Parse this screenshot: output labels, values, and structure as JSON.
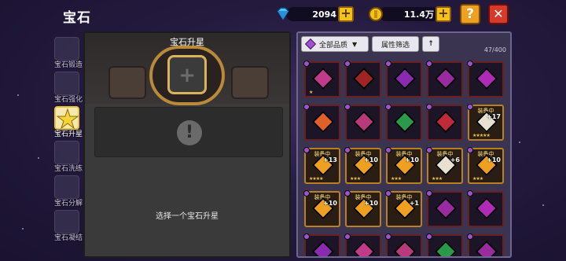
{
  "header": {
    "title": "宝石",
    "diamonds": "2094",
    "gold": "11.4万",
    "help_label": "?",
    "close_label": "✕",
    "diamond_color": "#4fc3f7",
    "gold_color": "#f5c21b"
  },
  "sidebar": {
    "items": [
      {
        "label": "宝石锻造",
        "icon": "gem-forge-icon",
        "active": false
      },
      {
        "label": "宝石强化",
        "icon": "gem-enhance-icon",
        "active": false
      },
      {
        "label": "宝石升星",
        "icon": "star-icon",
        "active": true
      },
      {
        "label": "宝石洗练",
        "icon": "gem-reroll-icon",
        "active": false
      },
      {
        "label": "宝石分解",
        "icon": "gem-dismantle-icon",
        "active": false
      },
      {
        "label": "宝石凝结",
        "icon": "gem-condense-icon",
        "active": false
      }
    ]
  },
  "center": {
    "title": "宝石升星",
    "slot_symbol": "+",
    "info_symbol": "!",
    "hint": "选择一个宝石升星"
  },
  "inventory": {
    "quality_filter": "全部品质",
    "attribute_filter": "属性筛选",
    "sort_symbol": "↑",
    "count": "47/400",
    "equipped_label": "装备中",
    "cells": [
      {
        "gem": "#c23a8a",
        "border": "red",
        "level": "",
        "equipped": false,
        "stars": "★"
      },
      {
        "gem": "#a02424",
        "border": "red",
        "level": "",
        "equipped": false,
        "stars": ""
      },
      {
        "gem": "#8a2ab0",
        "border": "red",
        "level": "",
        "equipped": false,
        "stars": ""
      },
      {
        "gem": "#9a2aa0",
        "border": "red",
        "level": "",
        "equipped": false,
        "stars": ""
      },
      {
        "gem": "#b02ab8",
        "border": "red",
        "level": "",
        "equipped": false,
        "stars": ""
      },
      {
        "gem": "#e0602a",
        "border": "red",
        "level": "",
        "equipped": false,
        "stars": ""
      },
      {
        "gem": "#b83a7a",
        "border": "red",
        "level": "",
        "equipped": false,
        "stars": ""
      },
      {
        "gem": "#2a9a4a",
        "border": "red",
        "level": "",
        "equipped": false,
        "stars": ""
      },
      {
        "gem": "#c02a3a",
        "border": "red",
        "level": "",
        "equipped": false,
        "stars": ""
      },
      {
        "gem": "#e8e0d0",
        "border": "gold",
        "level": "+17",
        "equipped": true,
        "stars": "★★★★★"
      },
      {
        "gem": "#f0a020",
        "border": "gold",
        "level": "+13",
        "equipped": true,
        "stars": "★★★★"
      },
      {
        "gem": "#f0a020",
        "border": "gold",
        "level": "+10",
        "equipped": true,
        "stars": "★★★"
      },
      {
        "gem": "#f0a020",
        "border": "gold",
        "level": "+10",
        "equipped": true,
        "stars": "★★★"
      },
      {
        "gem": "#e8e0d0",
        "border": "gold",
        "level": "+6",
        "equipped": true,
        "stars": "★★★"
      },
      {
        "gem": "#f0a020",
        "border": "gold",
        "level": "+10",
        "equipped": true,
        "stars": "★★★"
      },
      {
        "gem": "#f0a020",
        "border": "gold",
        "level": "+10",
        "equipped": true,
        "stars": ""
      },
      {
        "gem": "#f0a020",
        "border": "gold",
        "level": "+10",
        "equipped": true,
        "stars": ""
      },
      {
        "gem": "#f0a020",
        "border": "gold",
        "level": "+1",
        "equipped": true,
        "stars": ""
      },
      {
        "gem": "#9a2aa0",
        "border": "red",
        "level": "",
        "equipped": false,
        "stars": ""
      },
      {
        "gem": "#b02ab8",
        "border": "red",
        "level": "",
        "equipped": false,
        "stars": ""
      },
      {
        "gem": "#8a2ab0",
        "border": "red",
        "level": "",
        "equipped": false,
        "stars": ""
      },
      {
        "gem": "#c23a8a",
        "border": "red",
        "level": "",
        "equipped": false,
        "stars": ""
      },
      {
        "gem": "#b83a7a",
        "border": "red",
        "level": "",
        "equipped": false,
        "stars": ""
      },
      {
        "gem": "#2a9a4a",
        "border": "red",
        "level": "",
        "equipped": false,
        "stars": ""
      },
      {
        "gem": "#9a2aa0",
        "border": "red",
        "level": "",
        "equipped": false,
        "stars": ""
      }
    ]
  }
}
